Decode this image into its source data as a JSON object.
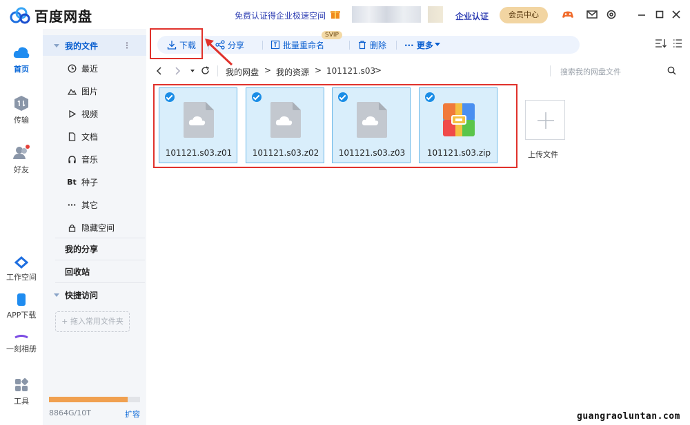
{
  "app": {
    "title": "百度网盘"
  },
  "header": {
    "promo": "免费认证得企业极速空间",
    "enterprise": "企业认证",
    "vip_center": "会员中心",
    "icons": [
      "game-icon",
      "mail-icon",
      "settings-icon",
      "minimize-icon",
      "maximize-icon",
      "close-icon"
    ]
  },
  "rail": {
    "items": [
      {
        "label": "首页",
        "icon": "cloud-icon"
      },
      {
        "label": "传输",
        "icon": "transfer-icon"
      },
      {
        "label": "好友",
        "icon": "friends-icon"
      },
      {
        "label": "工作空间",
        "icon": "workspace-icon"
      },
      {
        "label": "APP下载",
        "icon": "phone-icon"
      },
      {
        "label": "一刻相册",
        "icon": "album-icon"
      },
      {
        "label": "工具",
        "icon": "tools-icon"
      }
    ]
  },
  "sidebar": {
    "my_files": "我的文件",
    "items": [
      {
        "label": "最近",
        "icon": "clock-icon"
      },
      {
        "label": "图片",
        "icon": "image-icon"
      },
      {
        "label": "视频",
        "icon": "play-icon"
      },
      {
        "label": "文档",
        "icon": "document-icon"
      },
      {
        "label": "音乐",
        "icon": "headphone-icon"
      },
      {
        "label": "种子",
        "icon": "bt-icon",
        "glyph": "Bt"
      },
      {
        "label": "其它",
        "icon": "more-icon",
        "glyph": "···"
      },
      {
        "label": "隐藏空间",
        "icon": "lock-icon"
      }
    ],
    "my_share": "我的分享",
    "recycle": "回收站",
    "quick_access": "快捷访问",
    "add_folder": "+ 拖入常用文件夹",
    "storage": {
      "text": "8864G/10T",
      "fraction": 0.866,
      "expand": "扩容"
    }
  },
  "toolbar": {
    "download": "下载",
    "share": "分享",
    "rename": "批量重命名",
    "svip": "SVIP",
    "delete": "删除",
    "more": "··· 更多"
  },
  "nav": {
    "breadcrumb": [
      "我的网盘",
      "我的资源",
      "101121.s03"
    ],
    "search_placeholder": "搜索我的网盘文件"
  },
  "files": [
    {
      "name": "101121.s03.z01",
      "type": "generic"
    },
    {
      "name": "101121.s03.z02",
      "type": "generic"
    },
    {
      "name": "101121.s03.z03",
      "type": "generic"
    },
    {
      "name": "101121.s03.zip",
      "type": "zip"
    }
  ],
  "upload": {
    "label": "上传文件"
  },
  "watermark": "guangraoluntan.com",
  "colors": {
    "accent": "#0a68d8",
    "highlight": "#e0312b",
    "selected_bg": "#d9eefb"
  }
}
